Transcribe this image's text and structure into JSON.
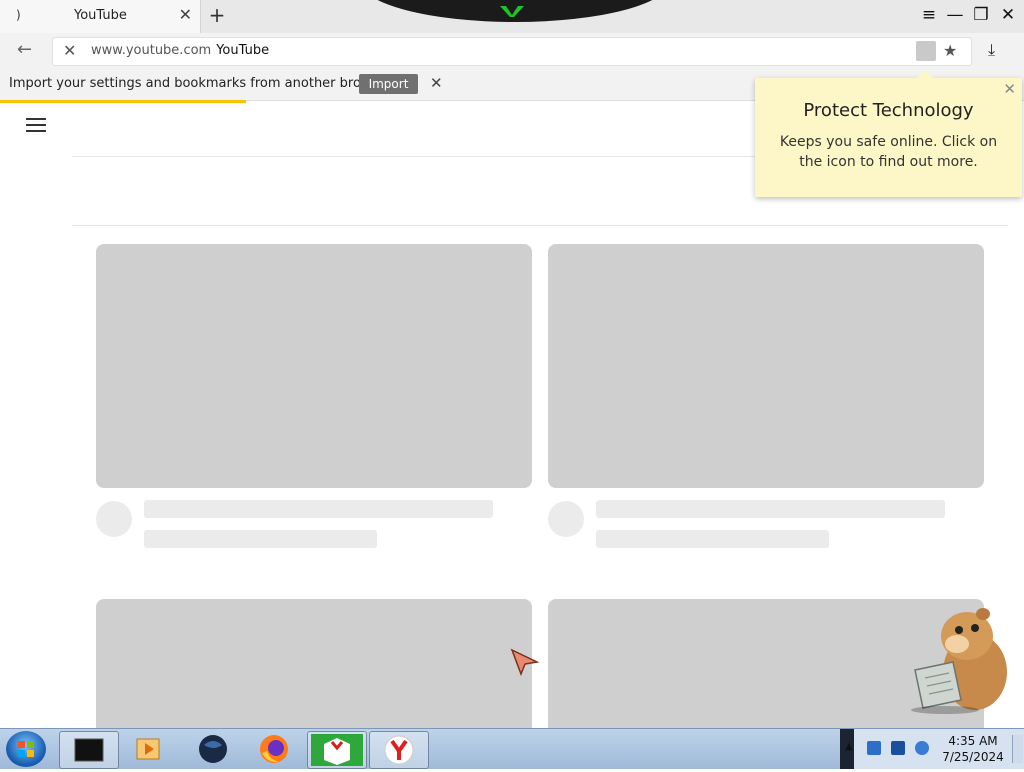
{
  "browser": {
    "tab": {
      "title": "YouTube",
      "spinner": ")"
    },
    "new_tab_label": "+",
    "window": {
      "menu": "≡",
      "minimize": "—",
      "restore": "❐",
      "close": "✕"
    },
    "address": {
      "back_glyph": "←",
      "stop_glyph": "✕",
      "domain": "www.youtube.com",
      "page_title": "YouTube",
      "star_glyph": "★",
      "download_glyph": "⤓"
    },
    "import_bar": {
      "message": "Import your settings and bookmarks from another browser.",
      "button_label": "Import",
      "close_glyph": "✕"
    },
    "loading_progress": 0.24
  },
  "protect_popup": {
    "title": "Protect Technology",
    "body": "Keeps you safe online. Click on the icon to find out more.",
    "close_glyph": "✕"
  },
  "taskbar": {
    "pinned": [
      {
        "name": "terminal-icon",
        "active": true
      },
      {
        "name": "media-player-icon",
        "active": false
      },
      {
        "name": "browser-globe-icon",
        "active": false
      },
      {
        "name": "firefox-icon",
        "active": false
      },
      {
        "name": "installer-box-icon",
        "active": true
      },
      {
        "name": "yandex-browser-icon",
        "active": true
      }
    ],
    "clock": {
      "time": "4:35 AM",
      "date": "7/25/2024"
    }
  },
  "colors": {
    "accent_yellow": "#f6c400",
    "popup_bg": "#fdf7c7",
    "skeleton_thumb": "#cfcfcf",
    "skeleton_line": "#ebebeb",
    "yandex_red": "#e02020"
  }
}
